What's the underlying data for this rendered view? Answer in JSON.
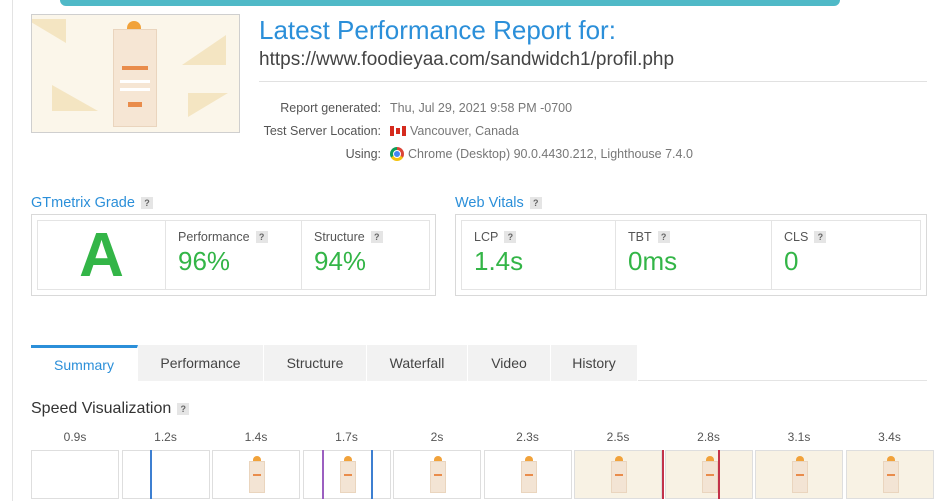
{
  "report": {
    "title": "Latest Performance Report for:",
    "url": "https://www.foodieyaa.com/sandwidch1/profil.php",
    "generated_label": "Report generated:",
    "generated_value": "Thu, Jul 29, 2021 9:58 PM -0700",
    "location_label": "Test Server Location:",
    "location_value": "Vancouver, Canada",
    "using_label": "Using:",
    "using_value": "Chrome (Desktop) 90.0.4430.212, Lighthouse 7.4.0",
    "thumbnail_icon": "page-screenshot-thumbnail"
  },
  "grade": {
    "heading": "GTmetrix Grade",
    "help": "?",
    "letter": "A",
    "performance_label": "Performance",
    "performance_value": "96%",
    "structure_label": "Structure",
    "structure_value": "94%"
  },
  "vitals": {
    "heading": "Web Vitals",
    "help": "?",
    "lcp_label": "LCP",
    "lcp_value": "1.4s",
    "tbt_label": "TBT",
    "tbt_value": "0ms",
    "cls_label": "CLS",
    "cls_value": "0"
  },
  "tabs": [
    "Summary",
    "Performance",
    "Structure",
    "Waterfall",
    "Video",
    "History"
  ],
  "speed": {
    "heading": "Speed Visualization",
    "help": "?",
    "ticks": [
      "0.9s",
      "1.2s",
      "1.4s",
      "1.7s",
      "2s",
      "2.3s",
      "2.5s",
      "2.8s",
      "3.1s",
      "3.4s"
    ]
  },
  "colors": {
    "accent": "#2b8fd9",
    "good": "#33b547",
    "marker_blue": "#3d7fd1",
    "marker_purple": "#9b5fc0",
    "marker_red": "#c2324a"
  }
}
